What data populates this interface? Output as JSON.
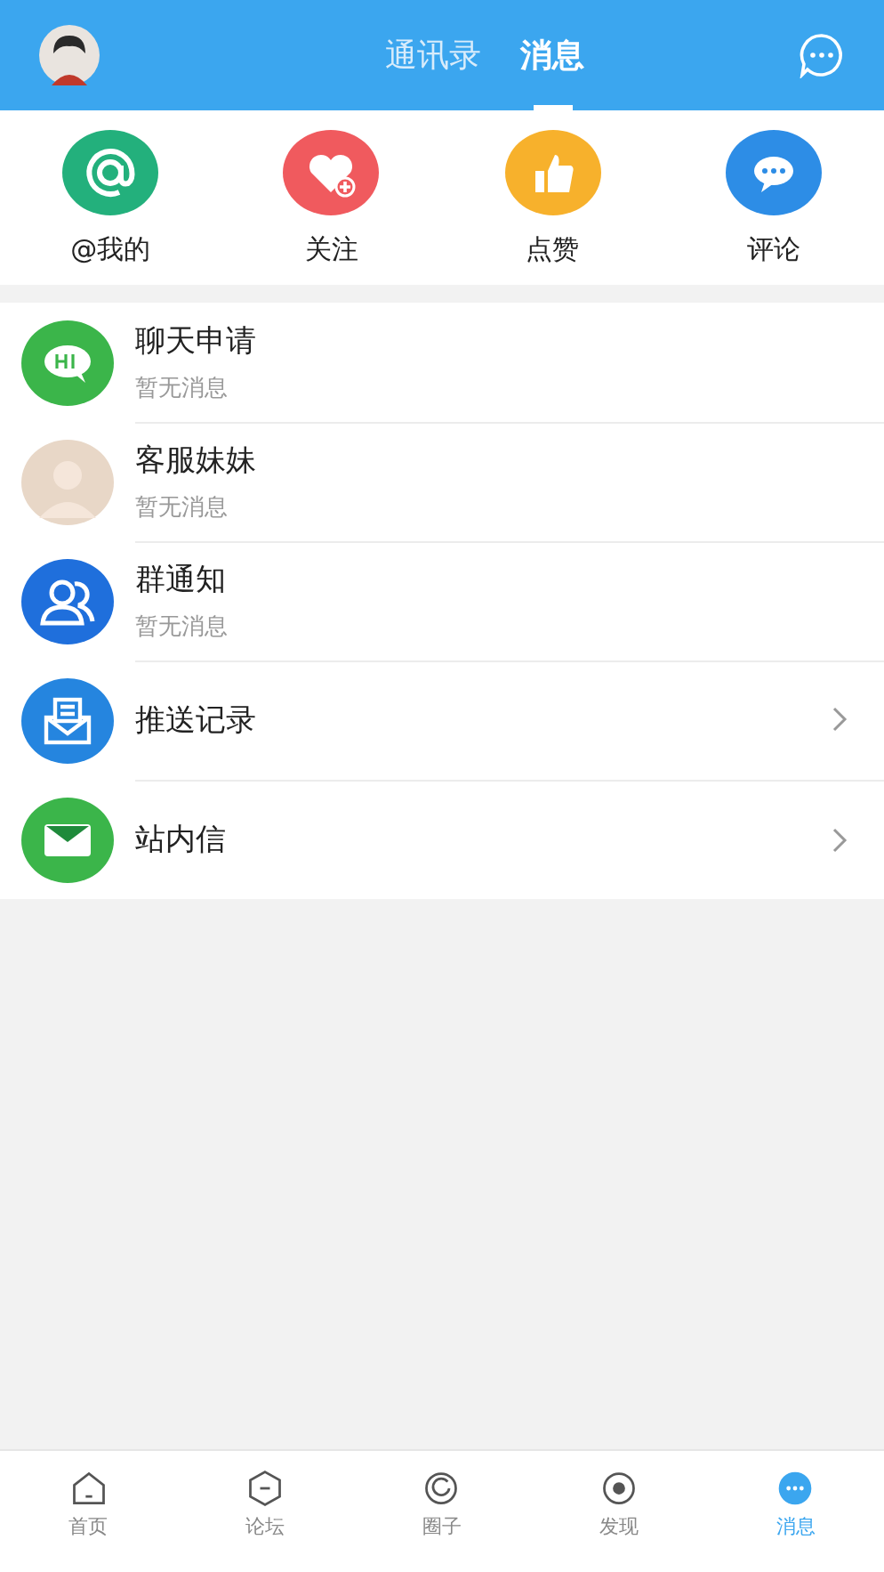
{
  "header": {
    "tabs": [
      {
        "label": "通讯录",
        "selected": false
      },
      {
        "label": "消息",
        "selected": true
      }
    ]
  },
  "shortcuts": [
    {
      "label": "@我的",
      "kind": "at",
      "color": "#23b07c"
    },
    {
      "label": "关注",
      "kind": "heart",
      "color": "#f05a5e"
    },
    {
      "label": "点赞",
      "kind": "thumb",
      "color": "#f7b12c"
    },
    {
      "label": "评论",
      "kind": "comment",
      "color": "#2d8de6"
    }
  ],
  "messages": [
    {
      "title": "聊天申请",
      "subtitle": "暂无消息",
      "kind": "hi",
      "arrow": false
    },
    {
      "title": "客服妹妹",
      "subtitle": "暂无消息",
      "kind": "avatar",
      "arrow": false
    },
    {
      "title": "群通知",
      "subtitle": "暂无消息",
      "kind": "group",
      "arrow": false
    },
    {
      "title": "推送记录",
      "kind": "push",
      "arrow": true
    },
    {
      "title": "站内信",
      "kind": "mail",
      "arrow": true
    }
  ],
  "bottom_nav": [
    {
      "label": "首页",
      "kind": "home",
      "selected": false
    },
    {
      "label": "论坛",
      "kind": "forum",
      "selected": false
    },
    {
      "label": "圈子",
      "kind": "circle",
      "selected": false
    },
    {
      "label": "发现",
      "kind": "discover",
      "selected": false
    },
    {
      "label": "消息",
      "kind": "message",
      "selected": true
    }
  ]
}
